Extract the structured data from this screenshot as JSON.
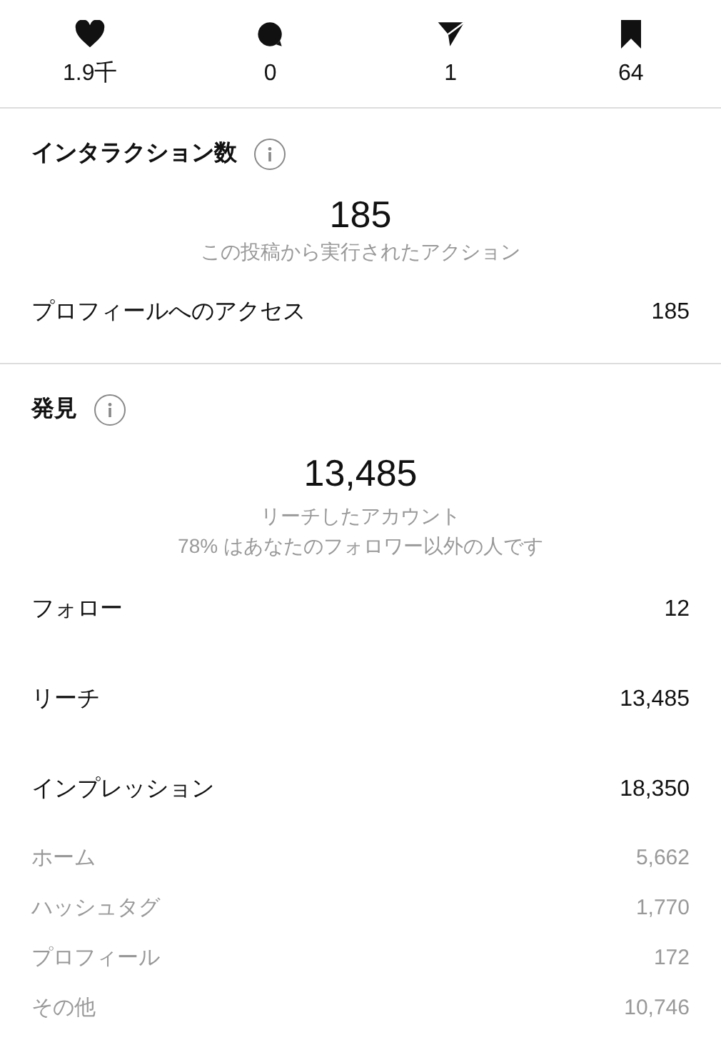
{
  "stats": [
    {
      "kind": "heart",
      "value": "1.9千"
    },
    {
      "kind": "comment",
      "value": "0"
    },
    {
      "kind": "send",
      "value": "1"
    },
    {
      "kind": "bookmark",
      "value": "64"
    }
  ],
  "interactions": {
    "title": "インタラクション数",
    "total": "185",
    "caption": "この投稿から実行されたアクション",
    "rows": [
      {
        "kind": "main",
        "label": "プロフィールへのアクセス",
        "value": "185"
      }
    ]
  },
  "discovery": {
    "title": "発見",
    "total": "13,485",
    "caption": "リーチしたアカウント",
    "note": "78% はあなたのフォロワー以外の人です",
    "rows": [
      {
        "kind": "main",
        "label": "フォロー",
        "value": "12"
      },
      {
        "kind": "main",
        "label": "リーチ",
        "value": "13,485"
      },
      {
        "kind": "main",
        "label": "インプレッション",
        "value": "18,350"
      },
      {
        "kind": "sub",
        "label": "ホーム",
        "value": "5,662"
      },
      {
        "kind": "sub",
        "label": "ハッシュタグ",
        "value": "1,770"
      },
      {
        "kind": "sub",
        "label": "プロフィール",
        "value": "172"
      },
      {
        "kind": "sub",
        "label": "その他",
        "value": "10,746"
      }
    ]
  }
}
